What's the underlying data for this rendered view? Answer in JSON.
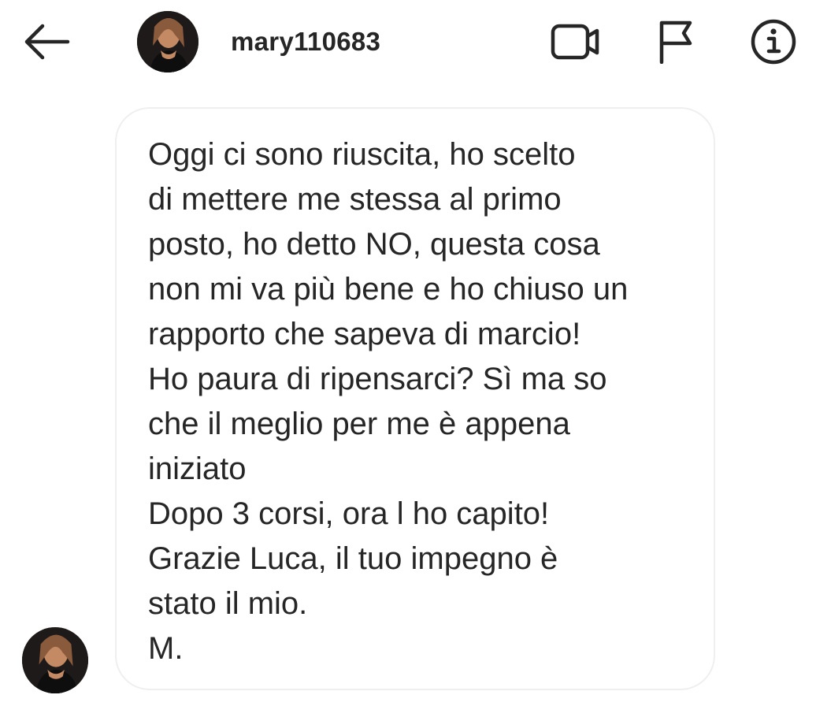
{
  "header": {
    "back_icon": "arrow-left-icon",
    "username": "mary110683",
    "actions": [
      {
        "name": "video-call",
        "icon": "video-camera-icon"
      },
      {
        "name": "report",
        "icon": "flag-icon"
      },
      {
        "name": "details",
        "icon": "info-icon"
      }
    ]
  },
  "conversation": {
    "message": "Oggi ci sono riuscita, ho scelto\ndi mettere me stessa al primo\nposto, ho detto NO, questa cosa\nnon mi va più bene e ho chiuso un\nrapporto che sapeva di marcio!\nHo paura di ripensarci? Sì ma so\nche il meglio per me è appena\niniziato\nDopo 3 corsi, ora l ho capito!\nGrazie Luca, il tuo impegno è\nstato il mio.\nM."
  },
  "colors": {
    "text": "#262626",
    "bubble_border": "#efefef",
    "background": "#ffffff"
  }
}
